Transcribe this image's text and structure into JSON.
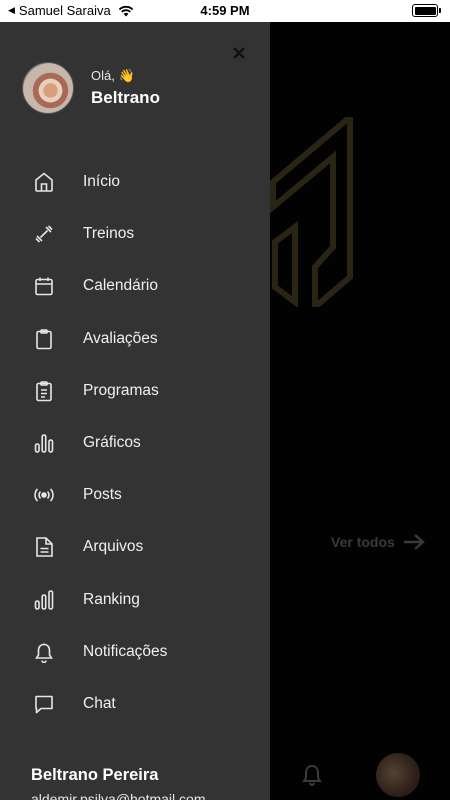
{
  "status_bar": {
    "back_indicator": "◀",
    "carrier": "Samuel Saraiva",
    "time": "4:59 PM"
  },
  "drawer": {
    "close_label": "×",
    "profile": {
      "greeting": "Olá, 👋",
      "name": "Beltrano"
    },
    "menu": [
      {
        "label": "Início",
        "icon": "home-icon"
      },
      {
        "label": "Treinos",
        "icon": "dumbbell-icon"
      },
      {
        "label": "Calendário",
        "icon": "calendar-icon"
      },
      {
        "label": "Avaliações",
        "icon": "clipboard-icon"
      },
      {
        "label": "Programas",
        "icon": "clipboard-list-icon"
      },
      {
        "label": "Gráficos",
        "icon": "bar-chart-icon"
      },
      {
        "label": "Posts",
        "icon": "broadcast-icon"
      },
      {
        "label": "Arquivos",
        "icon": "file-icon"
      },
      {
        "label": "Ranking",
        "icon": "ranking-icon"
      },
      {
        "label": "Notificações",
        "icon": "bell-icon"
      },
      {
        "label": "Chat",
        "icon": "chat-icon"
      }
    ],
    "footer": {
      "full_name": "Beltrano Pereira",
      "email": "aldemir.psilva@hotmail.com"
    }
  },
  "background": {
    "see_all_label": "Ver todos"
  },
  "colors": {
    "drawer_bg": "#333333",
    "backdrop": "#020202",
    "logo_accent": "#2a2414"
  }
}
